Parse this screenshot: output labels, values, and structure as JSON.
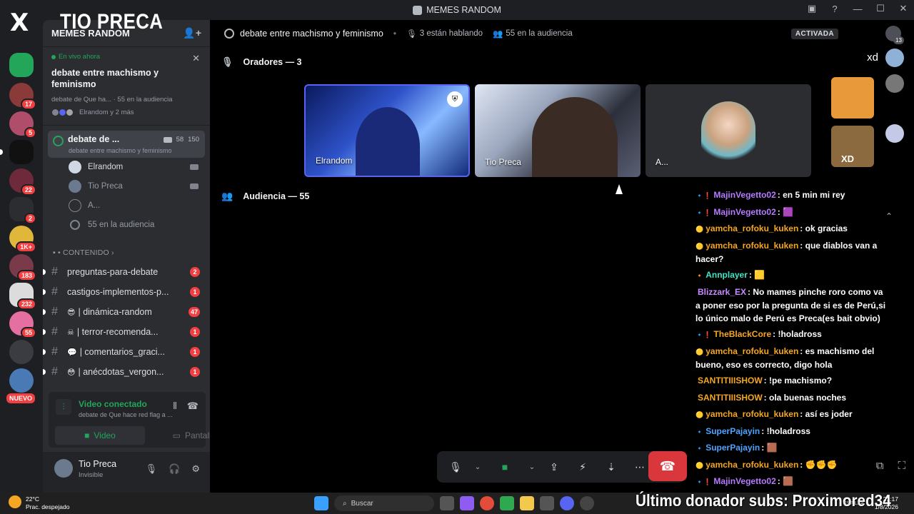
{
  "window": {
    "title": "MEMES RANDOM",
    "controls": [
      "▣",
      "?",
      "—",
      "☐",
      "✕"
    ]
  },
  "overlay": {
    "streamer_name": "TIO PRECA",
    "x_logo": "X",
    "xd_text": "xd",
    "thumb_xd": "XD"
  },
  "rail": {
    "badges": [
      "17",
      "5",
      "22",
      "2",
      "1K+",
      "183",
      "232",
      "55"
    ],
    "nuevo": "NUEVO"
  },
  "sidebar": {
    "server_name": "MEMES RANDOM",
    "live_label": "En vivo ahora",
    "stage_title": "debate entre machismo y feminismo",
    "stage_meta": "debate de Que ha... · 55 en la audiencia",
    "stage_people": "Elrandom y 2 más",
    "stage_channel": {
      "name": "debate de ...",
      "cam_count": "58",
      "listener_count": "150",
      "topic": "debate entre machismo y feminismo"
    },
    "members": [
      {
        "name": "Elrandom"
      },
      {
        "name": "Tio Preca"
      },
      {
        "name": "A..."
      }
    ],
    "audience": "55 en la audiencia",
    "category": "CONTENIDO",
    "channels": [
      {
        "emoji": "",
        "name": "preguntas-para-debate",
        "badge": "2"
      },
      {
        "emoji": "",
        "name": "castigos-implementos-p...",
        "badge": "1"
      },
      {
        "emoji": "😎",
        "name": "| dinámica-random",
        "badge": "47"
      },
      {
        "emoji": "☠",
        "name": "| terror-recomenda...",
        "badge": "1"
      },
      {
        "emoji": "💬",
        "name": "| comentarios_graci...",
        "badge": "1"
      },
      {
        "emoji": "😳",
        "name": "| anécdotas_vergon...",
        "badge": "1"
      }
    ],
    "voice_panel": {
      "status": "Video conectado",
      "sub": "debate de Que hace red flag a ...",
      "video_label": "Video",
      "screen_label": "Pantalla"
    },
    "user": {
      "name": "Tio Preca",
      "status": "Invisible"
    }
  },
  "main": {
    "stage_name": "debate entre machismo y feminismo",
    "speaking": "3 están hablando",
    "audience": "55 en la audiencia",
    "activada": "ACTIVADA",
    "notif_count": "13",
    "speakers_title": "Oradores — 3",
    "audience_title": "Audiencia — 55",
    "tiles": [
      {
        "label": "Elrandom"
      },
      {
        "label": "Tio Preca"
      },
      {
        "label": "A..."
      }
    ]
  },
  "chat": [
    {
      "dots": "🔹❗",
      "user": "MajinVegetto02",
      "color": "#b57aff",
      "text": ": en 5 min mi rey"
    },
    {
      "dots": "🔹❗",
      "user": "MajinVegetto02",
      "color": "#b57aff",
      "text": ": 🟪"
    },
    {
      "dots": "🟡",
      "user": "yamcha_rofoku_kuken",
      "color": "#f5a623",
      "text": ": ok gracias"
    },
    {
      "dots": "🟡",
      "user": "yamcha_rofoku_kuken",
      "color": "#f5a623",
      "text": ": que diablos van a hacer?"
    },
    {
      "dots": "🔸",
      "user": "Annplayer",
      "color": "#3ee6c1",
      "text": ": 🟨"
    },
    {
      "dots": "",
      "user": "Blizzark_EX",
      "color": "#c88cff",
      "text": ": No mames pinche roro como va a poner eso por la pregunta de si es de Perú,si lo único malo de Perú es Preca(es bait obvio)"
    },
    {
      "dots": "🔹❗",
      "user": "TheBlackCore",
      "color": "#f5a623",
      "text": ": !holadross"
    },
    {
      "dots": "🟡",
      "user": "yamcha_rofoku_kuken",
      "color": "#f5a623",
      "text": ": es machismo del bueno, eso es correcto, digo hola"
    },
    {
      "dots": "",
      "user": "SANTITIIISHOW",
      "color": "#f5a623",
      "text": ": !pe machismo?"
    },
    {
      "dots": "",
      "user": "SANTITIIISHOW",
      "color": "#f5a623",
      "text": ": ola buenas noches"
    },
    {
      "dots": "🟡",
      "user": "yamcha_rofoku_kuken",
      "color": "#f5a623",
      "text": ": así es joder"
    },
    {
      "dots": "🔹",
      "user": "SuperPajayin",
      "color": "#4da3ff",
      "text": ": !holadross"
    },
    {
      "dots": "🔹",
      "user": "SuperPajayin",
      "color": "#4da3ff",
      "text": ": 🟫"
    },
    {
      "dots": "🟡",
      "user": "yamcha_rofoku_kuken",
      "color": "#f5a623",
      "text": ": ✊✊✊"
    },
    {
      "dots": "🔹❗",
      "user": "MajinVegetto02",
      "color": "#b57aff",
      "text": ": 🟫"
    }
  ],
  "taskbar": {
    "weather_temp": "22°C",
    "weather_desc": "Prac. despejado",
    "search": "Buscar",
    "donor": "Último donador subs: Proximored34",
    "lang": "ESP LAA",
    "time": "21:17",
    "date": "1/8/2026"
  }
}
